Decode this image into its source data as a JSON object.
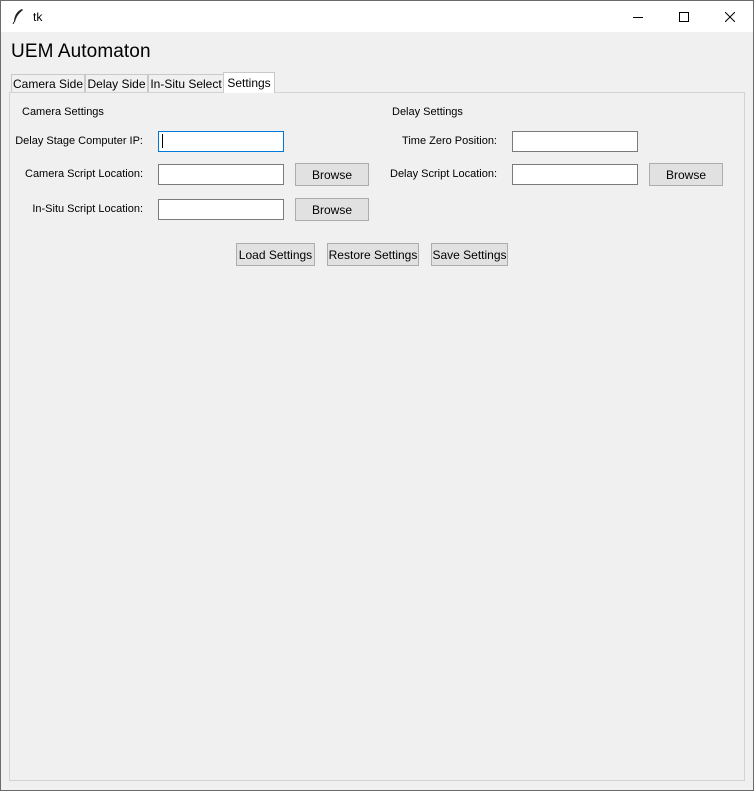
{
  "window": {
    "title": "tk",
    "icon": "feather-icon",
    "controls": [
      "minimize-icon",
      "maximize-icon",
      "close-icon"
    ]
  },
  "app": {
    "title": "UEM Automaton"
  },
  "tabs": [
    {
      "label": "Camera Side",
      "active": false
    },
    {
      "label": "Delay Side",
      "active": false
    },
    {
      "label": "In-Situ Select",
      "active": false
    },
    {
      "label": "Settings",
      "active": true
    }
  ],
  "camera_settings": {
    "heading": "Camera Settings",
    "delay_ip_label": "Delay Stage Computer IP:",
    "delay_ip_value": "",
    "camera_script_label": "Camera Script Location:",
    "camera_script_value": "",
    "insitu_script_label": "In-Situ Script Location:",
    "insitu_script_value": "",
    "browse_label": "Browse"
  },
  "delay_settings": {
    "heading": "Delay Settings",
    "time_zero_label": "Time Zero Position:",
    "time_zero_value": "",
    "delay_script_label": "Delay Script Location:",
    "delay_script_value": "",
    "browse_label": "Browse"
  },
  "actions": {
    "load": "Load Settings",
    "restore": "Restore Settings",
    "save": "Save Settings"
  },
  "colors": {
    "window_bg": "#f0f0f0",
    "focus_border": "#0078d7",
    "button_bg": "#e1e1e1"
  }
}
